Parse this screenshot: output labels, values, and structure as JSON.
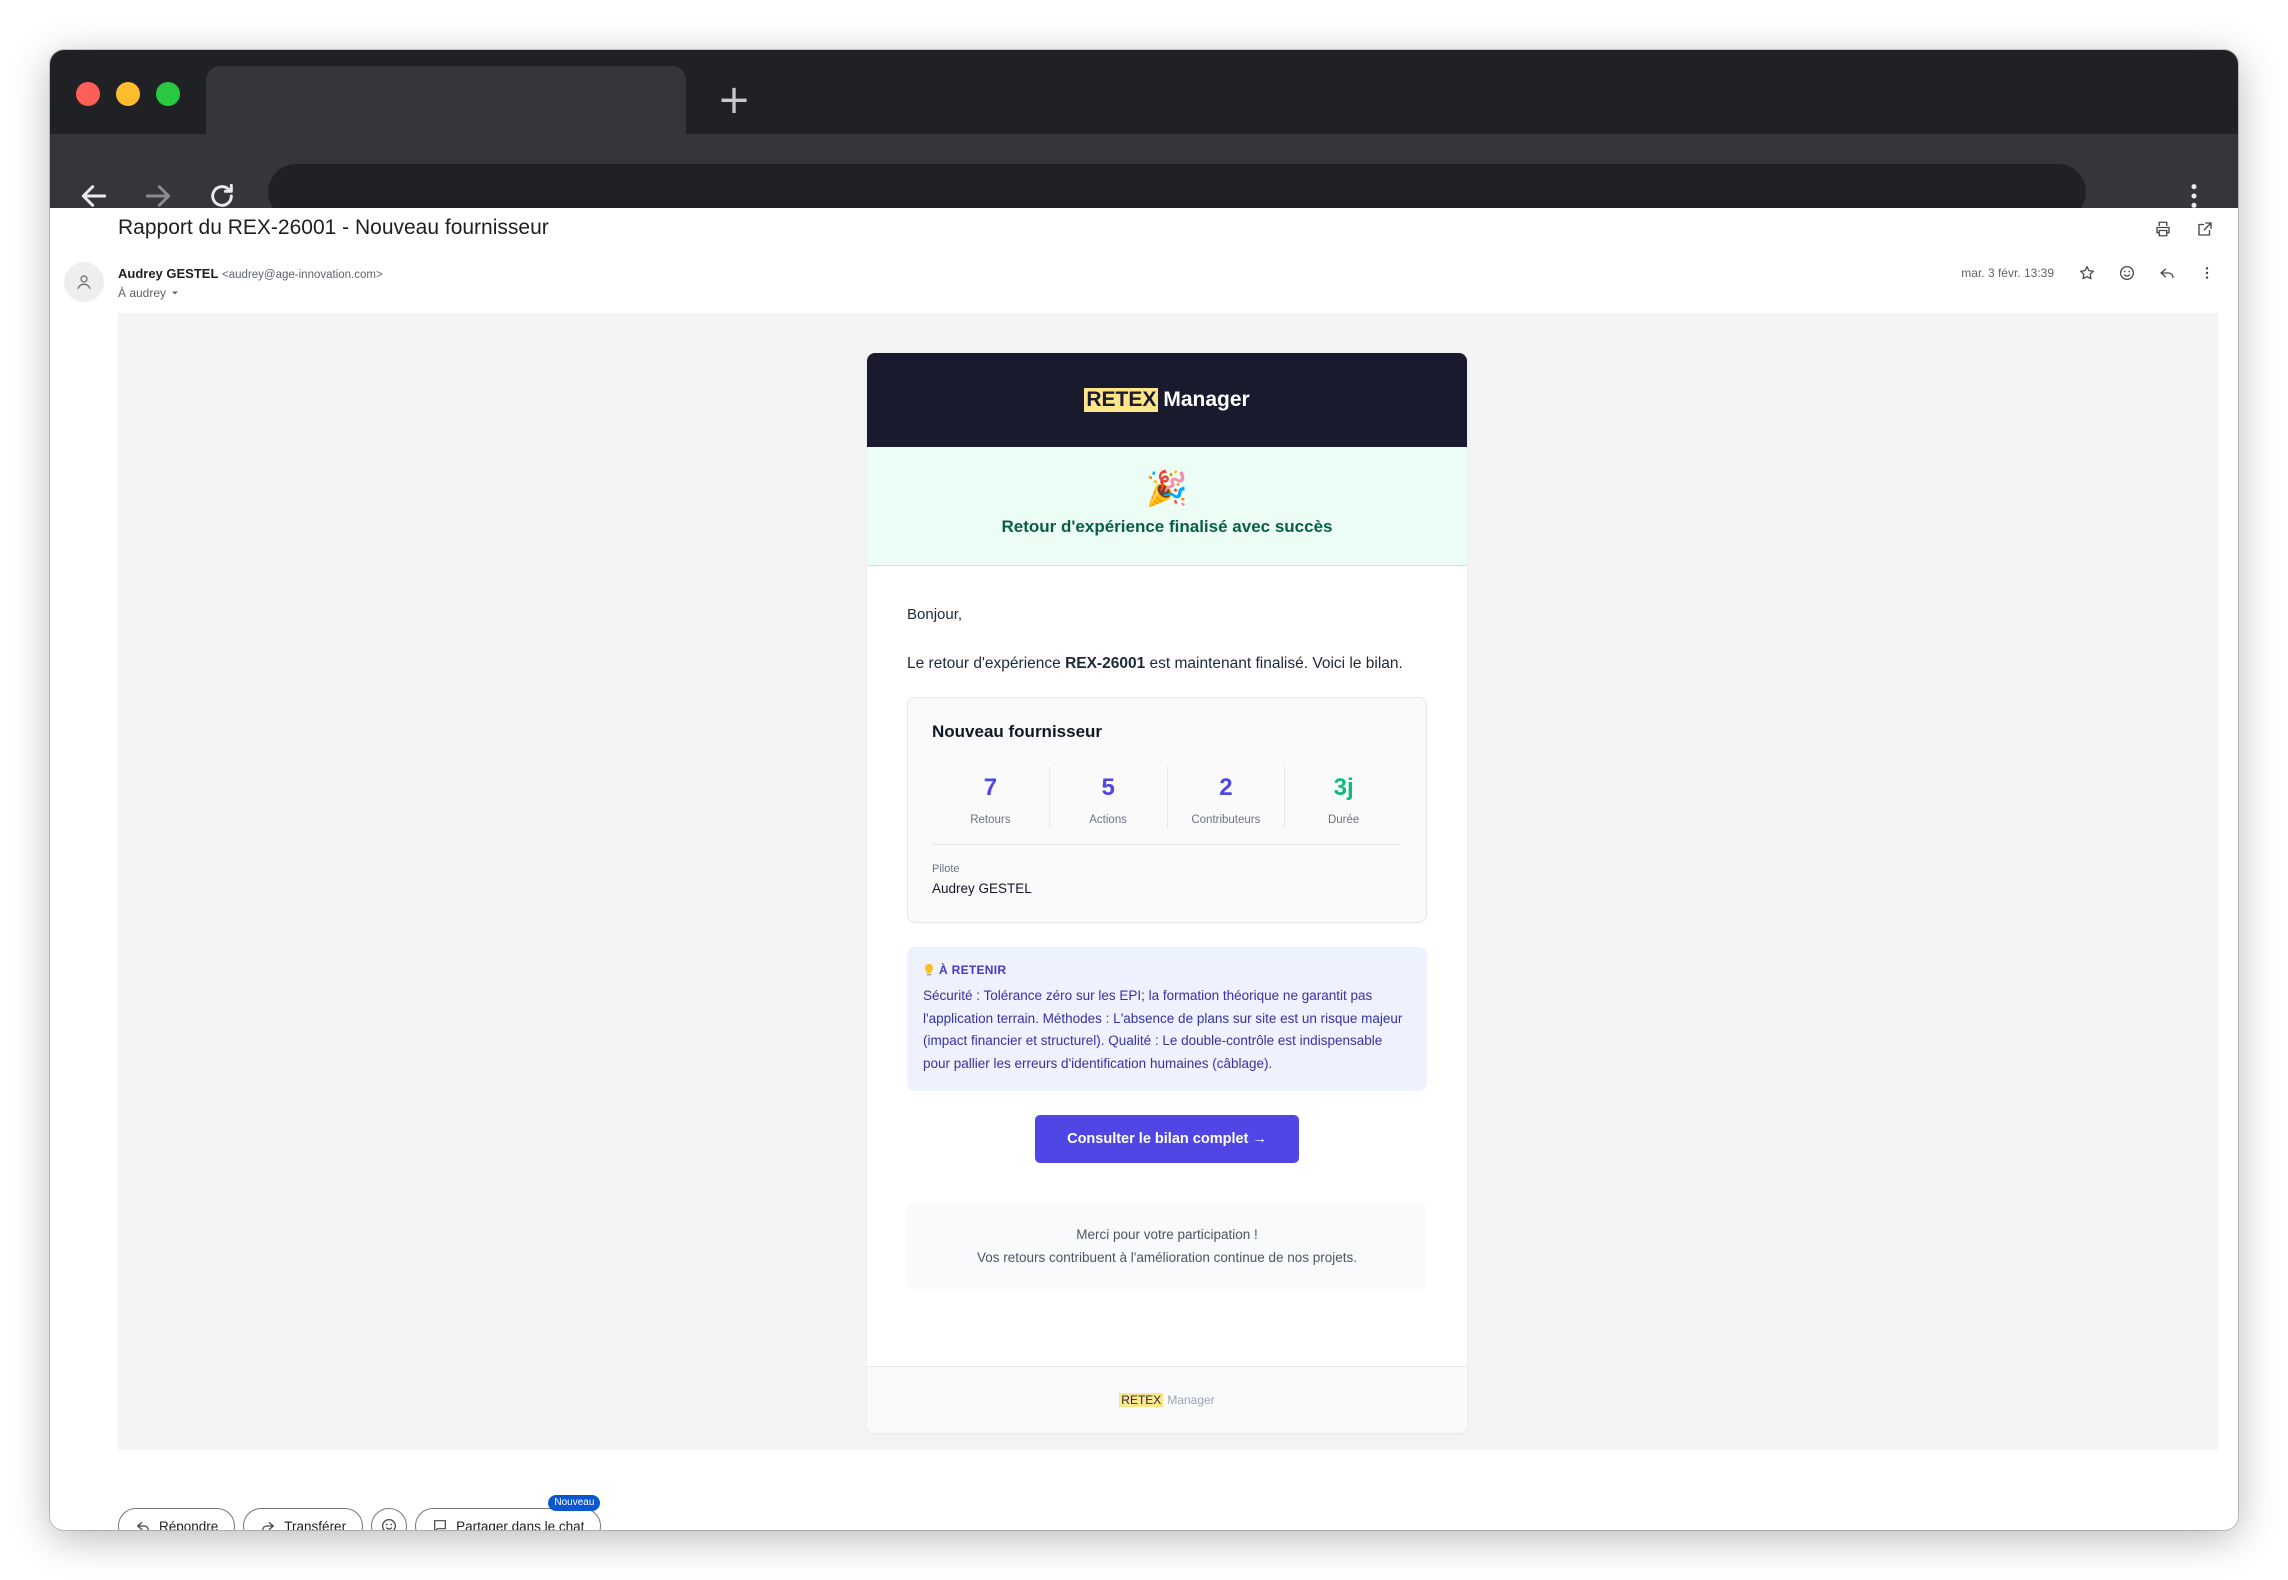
{
  "email": {
    "subject": "Rapport du REX-26001 - Nouveau fournisseur",
    "sender_name": "Audrey GESTEL",
    "sender_email": "<audrey@age-innovation.com>",
    "recipient": "À audrey",
    "date": "mar. 3 févr. 13:39"
  },
  "message": {
    "brand_highlight": "RETEX",
    "brand_rest": "Manager",
    "banner_emoji": "🎉",
    "banner_title": "Retour d'expérience finalisé avec succès",
    "greeting": "Bonjour,",
    "intro_before": "Le retour d'expérience ",
    "intro_code": "REX-26001",
    "intro_after": " est maintenant finalisé. Voici le bilan.",
    "summary_title": "Nouveau fournisseur",
    "stats": [
      {
        "value": "7",
        "label": "Retours",
        "color": "#4f46e5"
      },
      {
        "value": "5",
        "label": "Actions",
        "color": "#4f46e5"
      },
      {
        "value": "2",
        "label": "Contributeurs",
        "color": "#4f46e5"
      },
      {
        "value": "3j",
        "label": "Durée",
        "color": "#10b981"
      }
    ],
    "pilot_label": "Pilote",
    "pilot_name": "Audrey GESTEL",
    "retenir_title": "À RETENIR",
    "retenir_text": "Sécurité : Tolérance zéro sur les EPI; la formation théorique ne garantit pas l'application terrain. Méthodes : L'absence de plans sur site est un risque majeur (impact financier et structurel). Qualité : Le double-contrôle est indispensable pour pallier les erreurs d'identification humaines (câblage).",
    "cta_label": "Consulter le bilan complet →",
    "thanks_line1": "Merci pour votre participation !",
    "thanks_line2": "Vos retours contribuent à l'amélioration continue de nos projets."
  },
  "actions": {
    "reply": "Répondre",
    "forward": "Transférer",
    "share_chat": "Partager dans le chat",
    "new_badge": "Nouveau"
  },
  "colors": {
    "accent": "#4f46e5",
    "success": "#10b981",
    "header_bg": "#1a1a2e",
    "highlight": "#fde68a"
  }
}
